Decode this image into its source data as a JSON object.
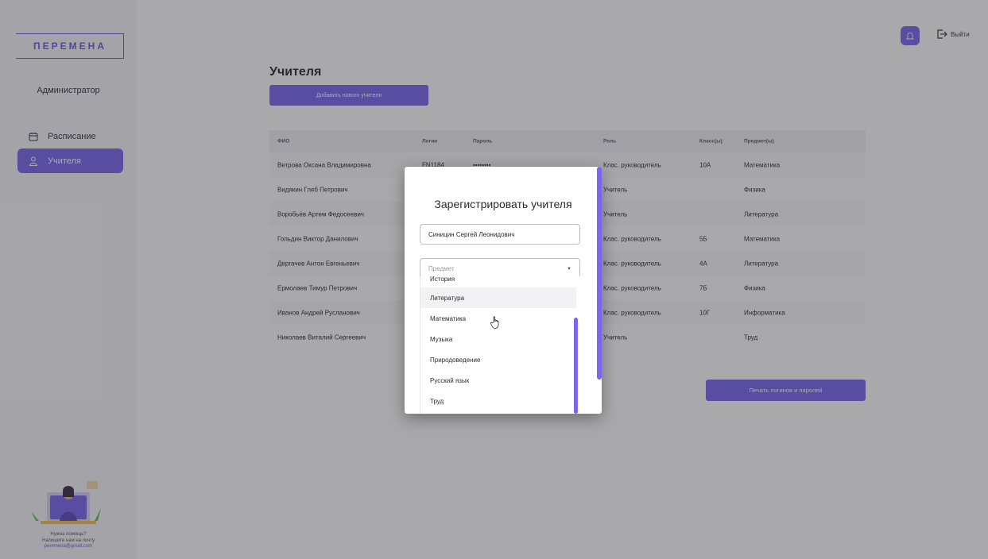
{
  "brand": "ПЕРЕМЕНА",
  "sidebar": {
    "role": "Администратор",
    "items": [
      {
        "label": "Расписание"
      },
      {
        "label": "Учителя"
      }
    ],
    "help": {
      "line1": "Нужна помощь?",
      "line2": "Напишите нам на почту",
      "email": "peremena@gmail.com"
    }
  },
  "topbar": {
    "logout_label": "Выйти"
  },
  "main": {
    "title": "Учителя",
    "add_button": "Добавить нового учителя",
    "print_button": "Печать логинов и паролей",
    "table": {
      "headers": [
        "ФИО",
        "Логин",
        "Пароль",
        "Роль",
        "Класс(ы)",
        "Предмет(ы)"
      ],
      "rows": [
        {
          "fio": "Ветрова Оксана Владимировна",
          "login": "FN1184",
          "password": "••••••••",
          "role": "Клас. руководитель",
          "class": "10А",
          "subject": "Математика"
        },
        {
          "fio": "Видякин Глеб Петрович",
          "login": "",
          "password": "",
          "role": "Учитель",
          "class": "",
          "subject": "Физика"
        },
        {
          "fio": "Воробьёв Артем Федосеевич",
          "login": "",
          "password": "",
          "role": "Учитель",
          "class": "",
          "subject": "Литература"
        },
        {
          "fio": "Гольдин Виктор Данилович",
          "login": "",
          "password": "",
          "role": "Клас. руководитель",
          "class": "5Б",
          "subject": "Математика"
        },
        {
          "fio": "Дергачев Антон Евгеньевич",
          "login": "",
          "password": "",
          "role": "Клас. руководитель",
          "class": "4А",
          "subject": "Литература"
        },
        {
          "fio": "Ермолаев Тимур Петрович",
          "login": "",
          "password": "",
          "role": "Клас. руководитель",
          "class": "7Б",
          "subject": "Физика"
        },
        {
          "fio": "Иванов Андрей Русланович",
          "login": "",
          "password": "",
          "role": "Клас. руководитель",
          "class": "10Г",
          "subject": "Информатика"
        },
        {
          "fio": "Николаев Виталий Сергеевич",
          "login": "",
          "password": "",
          "role": "Учитель",
          "class": "",
          "subject": "Труд"
        }
      ]
    }
  },
  "modal": {
    "title": "Зарегистрировать учителя",
    "name_value": "Синицин Сергей Леонидович",
    "subject_placeholder": "Предмет",
    "options": [
      "История",
      "Литература",
      "Математика",
      "Музыка",
      "Природоведение",
      "Русский язык",
      "Труд"
    ]
  },
  "colors": {
    "accent": "#7b66ee",
    "overlay": "rgba(40,40,48,0.40)"
  }
}
